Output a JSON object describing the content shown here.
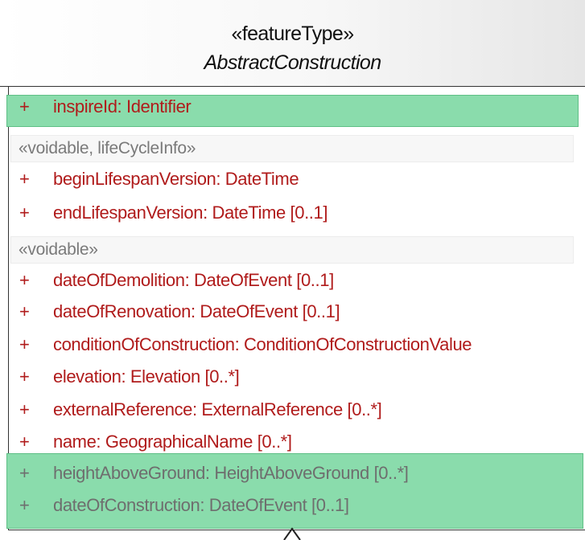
{
  "class": {
    "stereotype": "«featureType»",
    "name": "AbstractConstruction"
  },
  "groups": {
    "lifecycle_label": "«voidable, lifeCycleInfo»",
    "voidable_label": "«voidable»"
  },
  "attributes": [
    {
      "visibility": "+",
      "text": "inspireId:  Identifier"
    },
    {
      "visibility": "+",
      "text": "beginLifespanVersion:  DateTime"
    },
    {
      "visibility": "+",
      "text": "endLifespanVersion:  DateTime [0..1]"
    },
    {
      "visibility": "+",
      "text": "dateOfDemolition:  DateOfEvent [0..1]"
    },
    {
      "visibility": "+",
      "text": "dateOfRenovation:  DateOfEvent [0..1]"
    },
    {
      "visibility": "+",
      "text": "conditionOfConstruction:  ConditionOfConstructionValue"
    },
    {
      "visibility": "+",
      "text": "elevation:  Elevation [0..*]"
    },
    {
      "visibility": "+",
      "text": "externalReference:  ExternalReference [0..*]"
    },
    {
      "visibility": "+",
      "text": "name:  GeographicalName [0..*]"
    },
    {
      "visibility": "+",
      "text": "heightAboveGround:  HeightAboveGround [0..*]"
    },
    {
      "visibility": "+",
      "text": "dateOfConstruction:  DateOfEvent [0..1]"
    }
  ],
  "colors": {
    "attribute_text": "#b01b1b",
    "highlight": "#8adcac",
    "section_label": "#7a7a7a",
    "border": "#333333"
  }
}
